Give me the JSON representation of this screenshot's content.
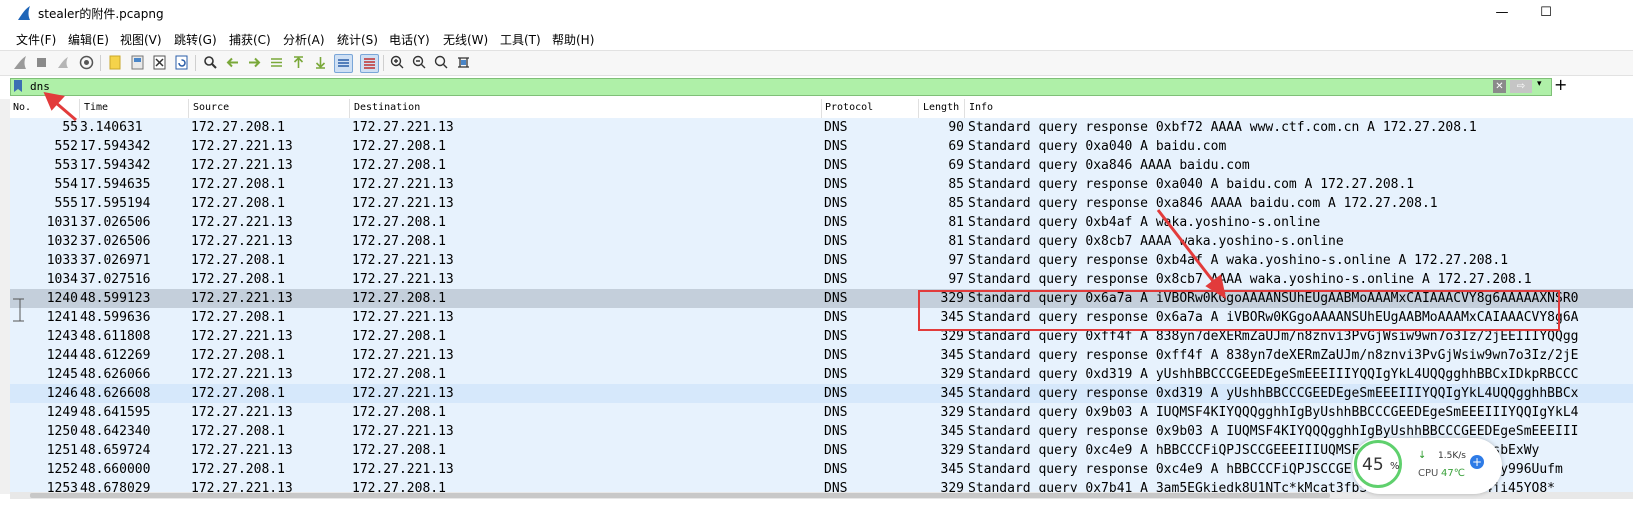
{
  "window": {
    "title": "stealer的附件.pcapng",
    "minimize": "—",
    "maximize": "☐"
  },
  "menu": [
    {
      "label": "文件(F)"
    },
    {
      "label": "编辑(E)"
    },
    {
      "label": "视图(V)"
    },
    {
      "label": "跳转(G)"
    },
    {
      "label": "捕获(C)"
    },
    {
      "label": "分析(A)"
    },
    {
      "label": "统计(S)"
    },
    {
      "label": "电话(Y)"
    },
    {
      "label": "无线(W)"
    },
    {
      "label": "工具(T)"
    },
    {
      "label": "帮助(H)"
    }
  ],
  "toolbar_icons": [
    "shark-fin-start-icon",
    "stop-capture-icon",
    "restart-capture-icon",
    "capture-options-icon",
    "open-file-icon",
    "save-file-icon",
    "close-file-icon",
    "reload-file-icon",
    "find-packet-icon",
    "go-back-icon",
    "go-forward-icon",
    "go-to-packet-icon",
    "first-packet-icon",
    "last-packet-icon",
    "autoscroll-icon",
    "colorize-icon",
    "zoom-in-icon",
    "zoom-out-icon",
    "normal-size-icon",
    "resize-columns-icon"
  ],
  "filter": {
    "value": "dns",
    "clear": "✕",
    "apply": "⇨",
    "dropdown": "▾",
    "add": "+"
  },
  "columns": {
    "no": "No.",
    "time": "Time",
    "source": "Source",
    "destination": "Destination",
    "protocol": "Protocol",
    "length": "Length",
    "info": "Info"
  },
  "packets": [
    {
      "no": "55",
      "time": "3.140631",
      "src": "172.27.208.1",
      "dst": "172.27.221.13",
      "proto": "DNS",
      "len": "90",
      "info": "Standard query response 0xbf72 AAAA www.ctf.com.cn A 172.27.208.1",
      "style": "light"
    },
    {
      "no": "552",
      "time": "17.594342",
      "src": "172.27.221.13",
      "dst": "172.27.208.1",
      "proto": "DNS",
      "len": "69",
      "info": "Standard query 0xa040 A baidu.com",
      "style": "light"
    },
    {
      "no": "553",
      "time": "17.594342",
      "src": "172.27.221.13",
      "dst": "172.27.208.1",
      "proto": "DNS",
      "len": "69",
      "info": "Standard query 0xa846 AAAA baidu.com",
      "style": "light"
    },
    {
      "no": "554",
      "time": "17.594635",
      "src": "172.27.208.1",
      "dst": "172.27.221.13",
      "proto": "DNS",
      "len": "85",
      "info": "Standard query response 0xa040 A baidu.com A 172.27.208.1",
      "style": "light"
    },
    {
      "no": "555",
      "time": "17.595194",
      "src": "172.27.208.1",
      "dst": "172.27.221.13",
      "proto": "DNS",
      "len": "85",
      "info": "Standard query response 0xa846 AAAA baidu.com A 172.27.208.1",
      "style": "light"
    },
    {
      "no": "1031",
      "time": "37.026506",
      "src": "172.27.221.13",
      "dst": "172.27.208.1",
      "proto": "DNS",
      "len": "81",
      "info": "Standard query 0xb4af A waka.yoshino-s.online",
      "style": "light"
    },
    {
      "no": "1032",
      "time": "37.026506",
      "src": "172.27.221.13",
      "dst": "172.27.208.1",
      "proto": "DNS",
      "len": "81",
      "info": "Standard query 0x8cb7 AAAA waka.yoshino-s.online",
      "style": "light"
    },
    {
      "no": "1033",
      "time": "37.026971",
      "src": "172.27.208.1",
      "dst": "172.27.221.13",
      "proto": "DNS",
      "len": "97",
      "info": "Standard query response 0xb4af A waka.yoshino-s.online A 172.27.208.1",
      "style": "light"
    },
    {
      "no": "1034",
      "time": "37.027516",
      "src": "172.27.208.1",
      "dst": "172.27.221.13",
      "proto": "DNS",
      "len": "97",
      "info": "Standard query response 0x8cb7 AAAA waka.yoshino-s.online A 172.27.208.1",
      "style": "light"
    },
    {
      "no": "1240",
      "time": "48.599123",
      "src": "172.27.221.13",
      "dst": "172.27.208.1",
      "proto": "DNS",
      "len": "329",
      "info": "Standard query 0x6a7a A iVBORw0KGgoAAAANSUhEUgAABMoAAAMxCAIAAACVY8g6AAAAAXNSR0",
      "style": "selected"
    },
    {
      "no": "1241",
      "time": "48.599636",
      "src": "172.27.208.1",
      "dst": "172.27.221.13",
      "proto": "DNS",
      "len": "345",
      "info": "Standard query response 0x6a7a A iVBORw0KGgoAAAANSUhEUgAABMoAAAMxCAIAAACVY8g6A",
      "style": "light"
    },
    {
      "no": "1243",
      "time": "48.611808",
      "src": "172.27.221.13",
      "dst": "172.27.208.1",
      "proto": "DNS",
      "len": "329",
      "info": "Standard query 0xff4f A 838yn7deXERmZaUJm/n8znvi3PvGjWsiw9wn7o3Iz/2jEEIIIYQQgg",
      "style": "light"
    },
    {
      "no": "1244",
      "time": "48.612269",
      "src": "172.27.208.1",
      "dst": "172.27.221.13",
      "proto": "DNS",
      "len": "345",
      "info": "Standard query response 0xff4f A 838yn7deXERmZaUJm/n8znvi3PvGjWsiw9wn7o3Iz/2jE",
      "style": "light"
    },
    {
      "no": "1245",
      "time": "48.626066",
      "src": "172.27.221.13",
      "dst": "172.27.208.1",
      "proto": "DNS",
      "len": "329",
      "info": "Standard query 0xd319 A yUshhBBCCCGEEDEgeSmEEEIIIYQQIgYkL4UQQgghhBBCxIDkpRBCCC",
      "style": "light"
    },
    {
      "no": "1246",
      "time": "48.626608",
      "src": "172.27.208.1",
      "dst": "172.27.221.13",
      "proto": "DNS",
      "len": "345",
      "info": "Standard query response 0xd319 A yUshhBBCCCGEEDEgeSmEEEIIIYQQIgYkL4UQQgghhBBCx",
      "style": "mid"
    },
    {
      "no": "1249",
      "time": "48.641595",
      "src": "172.27.221.13",
      "dst": "172.27.208.1",
      "proto": "DNS",
      "len": "329",
      "info": "Standard query 0x9b03 A IUQMSF4KIYQQQgghhIgByUshhBBCCCGEEDEgeSmEEEIIIYQQIgYkL4",
      "style": "light"
    },
    {
      "no": "1250",
      "time": "48.642340",
      "src": "172.27.208.1",
      "dst": "172.27.221.13",
      "proto": "DNS",
      "len": "345",
      "info": "Standard query response 0x9b03 A IUQMSF4KIYQQQgghhIgByUshhBBCCCGEEDEgeSmEEEIII",
      "style": "light"
    },
    {
      "no": "1251",
      "time": "48.659724",
      "src": "172.27.221.13",
      "dst": "172.27.208.1",
      "proto": "DNS",
      "len": "329",
      "info": "Standard query 0xc4e9 A hBBCCCFiQPJSCCGEEEIIIUQMSF4KIYQQQgghhI5mwbhsbExWy",
      "style": "light"
    },
    {
      "no": "1252",
      "time": "48.660000",
      "src": "172.27.208.1",
      "dst": "172.27.221.13",
      "proto": "DNS",
      "len": "345",
      "info": "Standard query response 0xc4e9 A hBBCCCFiQPJSCCGEEEIIIUQMSF4KIYQQQnwy996Uufm",
      "style": "light"
    },
    {
      "no": "1253",
      "time": "48.678029",
      "src": "172.27.221.13",
      "dst": "172.27.208.1",
      "proto": "DNS",
      "len": "329",
      "info": "Standard query 0x7b41 A 3am5EGkiedk8U1NTc*kMcat3fbSTQn7/5Z/*57+4dS4ji45YQ8*",
      "style": "light"
    }
  ],
  "monitor": {
    "cpu_percent": "45",
    "percent_sign": "%",
    "net_speed": "1.5K/s",
    "cpu_label": "CPU",
    "cpu_temp": "47℃",
    "plus": "+"
  },
  "colors": {
    "row_light": "#e7f2fd",
    "row_selected": "#c4cfdb",
    "row_mid": "#d6e8fb",
    "filter_bg": "#aff0a8",
    "annotation_red": "#e23b3b"
  }
}
